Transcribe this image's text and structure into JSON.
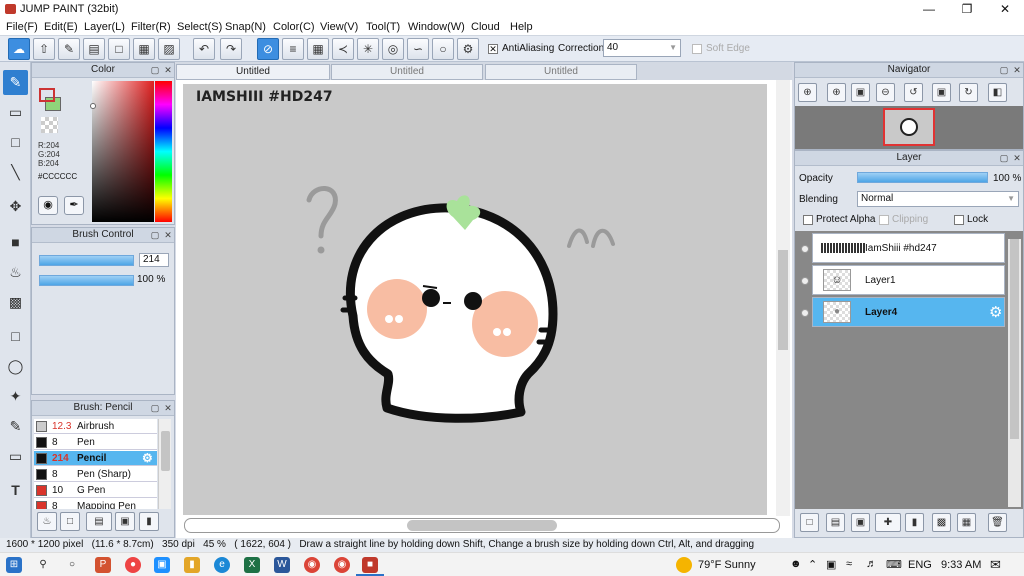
{
  "window": {
    "title": "JUMP PAINT (32bit)"
  },
  "menu": [
    "File(F)",
    "Edit(E)",
    "Layer(L)",
    "Filter(R)",
    "Select(S)",
    "Snap(N)",
    "Color(C)",
    "View(V)",
    "Tool(T)",
    "Window(W)",
    "Cloud",
    "Help"
  ],
  "toolbar": {
    "antialiasing_label": "AntiAliasing",
    "correction_label": "Correction",
    "correction_value": "40",
    "soft_edge_label": "Soft Edge"
  },
  "color_panel": {
    "title": "Color",
    "r": "R:204",
    "g": "G:204",
    "b": "B:204",
    "hex": "#CCCCCC",
    "main_color": "#cc3333"
  },
  "brush_control": {
    "title": "Brush Control",
    "size": "214",
    "opacity": "100 %"
  },
  "brush_list": {
    "title": "Brush: Pencil",
    "items": [
      {
        "size": "12.3",
        "name": "Airbrush",
        "swatch": "#cccccc",
        "size_color": "#d9342b"
      },
      {
        "size": "8",
        "name": "Pen",
        "swatch": "#111111",
        "size_color": "#111111"
      },
      {
        "size": "214",
        "name": "Pencil",
        "swatch": "#111111",
        "size_color": "#d9342b",
        "selected": true
      },
      {
        "size": "8",
        "name": "Pen (Sharp)",
        "swatch": "#111111",
        "size_color": "#111111"
      },
      {
        "size": "10",
        "name": "G Pen",
        "swatch": "#d9342b",
        "size_color": "#111111"
      },
      {
        "size": "8",
        "name": "Mapping Pen",
        "swatch": "#d9342b",
        "size_color": "#111111"
      }
    ]
  },
  "tabs": [
    "Untitled",
    "Untitled",
    "Untitled"
  ],
  "canvas": {
    "watermark": "IAMSHIII #HD247"
  },
  "navigator": {
    "title": "Navigator"
  },
  "layer_panel": {
    "title": "Layer",
    "opacity_label": "Opacity",
    "opacity_value": "100 %",
    "blending_label": "Blending",
    "blending_value": "Normal",
    "protect_alpha": "Protect Alpha",
    "clipping": "Clipping",
    "lock": "Lock",
    "layers": [
      {
        "name": "IamShiii #hd247",
        "selected": false
      },
      {
        "name": "Layer1",
        "selected": false
      },
      {
        "name": "Layer4",
        "selected": true
      }
    ]
  },
  "status": {
    "text": "1600 * 1200 pixel   (11.6 * 8.7cm)   350 dpi   45 %   ( 1622, 604 )   Draw a straight line by holding down Shift, Change a brush size by holding down Ctrl, Alt, and dragging"
  },
  "taskbar": {
    "weather": "79°F  Sunny",
    "lang": "ENG",
    "time": "9:33 AM"
  }
}
